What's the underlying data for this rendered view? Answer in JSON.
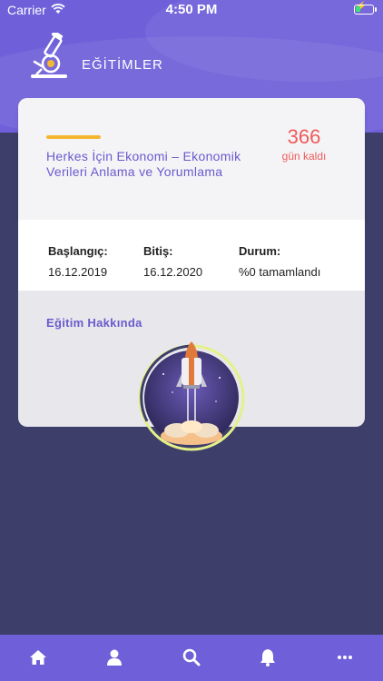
{
  "status_bar": {
    "carrier": "Carrier",
    "time": "4:50 PM"
  },
  "header": {
    "title": "EĞİTİMLER",
    "logo_icon": "microscope-icon"
  },
  "course": {
    "title": "Herkes İçin Ekonomi – Ekonomik Verileri Anlama ve Yorumlama",
    "days_left_value": "366",
    "days_left_label": "gün kaldı",
    "start_label": "Başlangıç:",
    "start_value": "16.12.2019",
    "end_label": "Bitiş:",
    "end_value": "16.12.2020",
    "status_label": "Durum:",
    "status_value": "%0 tamamlandı",
    "about_label": "Eğitim Hakkında",
    "illustration_icon": "rocket-launch-icon"
  },
  "nav": {
    "items": [
      {
        "icon": "home-icon"
      },
      {
        "icon": "user-icon"
      },
      {
        "icon": "search-icon"
      },
      {
        "icon": "bell-icon"
      },
      {
        "icon": "more-icon"
      }
    ]
  },
  "colors": {
    "primary": "#6f5fd9",
    "background": "#3d3f6a",
    "accent": "#f5b731",
    "days_left": "#f05a5a",
    "link_text": "#6a5acd"
  }
}
